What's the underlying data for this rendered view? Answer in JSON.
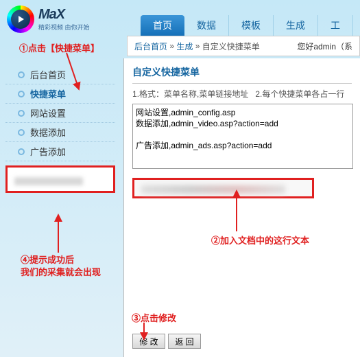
{
  "logo": {
    "brand": "MaX",
    "slogan": "精彩视频 由你开始"
  },
  "topnav": [
    "首页",
    "数据",
    "模板",
    "生成",
    "工"
  ],
  "breadcrumb": {
    "a": "后台首页",
    "b": "生成",
    "c": "自定义快捷菜单"
  },
  "greet": "您好admin（系",
  "sidebar": [
    "后台首页",
    "快捷菜单",
    "网站设置",
    "数据添加",
    "广告添加"
  ],
  "page": {
    "title": "自定义快捷菜单",
    "hint1": "1.格式：菜单名称,菜单链接地址",
    "hint2": "2.每个快捷菜单各占一行",
    "textarea": "网站设置,admin_config.asp\n数据添加,admin_video.asp?action=add\n\n广告添加,admin_ads.asp?action=add"
  },
  "buttons": {
    "submit": "修 改",
    "back": "返 回"
  },
  "anno": {
    "a1": "①点击【快捷菜单】",
    "a2": "②加入文档中的这行文本",
    "a3": "③点击修改",
    "a4a": "④提示成功后",
    "a4b": "我们的采集就会出现"
  }
}
